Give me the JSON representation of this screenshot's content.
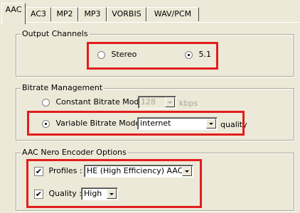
{
  "tabs": [
    {
      "label": "AAC",
      "active": true
    },
    {
      "label": "AC3"
    },
    {
      "label": "MP2"
    },
    {
      "label": "MP3"
    },
    {
      "label": "VORBIS"
    },
    {
      "label": "WAV/PCM"
    }
  ],
  "output_channels": {
    "title": "Output Channels",
    "stereo_label": "Stereo",
    "surround_label": "5.1",
    "selected": "5.1"
  },
  "bitrate": {
    "title": "Bitrate Management",
    "cbr_label": "Constant Bitrate Mode :",
    "cbr_value": "128",
    "cbr_unit": "kbps",
    "vbr_label": "Variable Bitrate Mode :",
    "vbr_value": "internet",
    "vbr_unit": "quality",
    "selected": "Variable Bitrate Mode"
  },
  "nero": {
    "title": "AAC Nero Encoder Options",
    "profiles_label": "Profiles :",
    "profiles_value": "HE (High Efficiency) AAC",
    "profiles_checked": true,
    "quality_label": "Quality :",
    "quality_value": "High",
    "quality_checked": true
  },
  "colors": {
    "highlight": "#e31d1d",
    "background": "#ece9d8"
  }
}
